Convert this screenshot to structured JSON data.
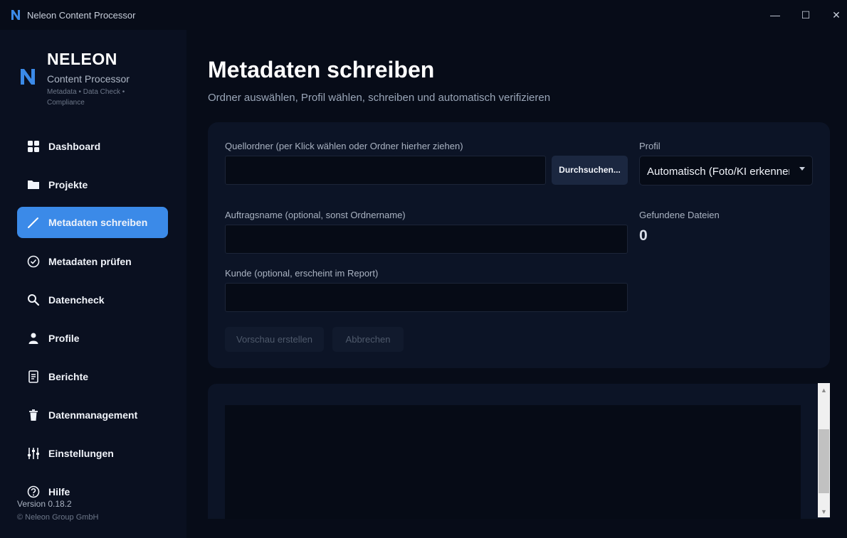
{
  "window": {
    "title": "Neleon Content Processor",
    "minimize_glyph": "—",
    "maximize_glyph": "☐",
    "close_glyph": "✕"
  },
  "brand": {
    "logo_letter": "N",
    "name": "NELEON",
    "subtitle": "Content Processor",
    "tagline": "Metadata • Data Check • Compliance",
    "accent_color": "#3b8ae8"
  },
  "sidebar": {
    "items": [
      {
        "label": "Dashboard",
        "icon": "grid-icon"
      },
      {
        "label": "Projekte",
        "icon": "folder-icon"
      },
      {
        "label": "Metadaten schreiben",
        "icon": "pencil-icon",
        "active": true
      },
      {
        "label": "Metadaten prüfen",
        "icon": "check-circle-icon"
      },
      {
        "label": "Datencheck",
        "icon": "search-icon"
      },
      {
        "label": "Profile",
        "icon": "person-icon"
      },
      {
        "label": "Berichte",
        "icon": "document-icon"
      },
      {
        "label": "Datenmanagement",
        "icon": "trash-icon"
      },
      {
        "label": "Einstellungen",
        "icon": "sliders-icon"
      },
      {
        "label": "Hilfe",
        "icon": "help-icon"
      }
    ],
    "version": "Version 0.18.2",
    "copyright": "© Neleon Group GmbH"
  },
  "main": {
    "title": "Metadaten schreiben",
    "subtitle": "Ordner auswählen, Profil wählen, schreiben und automatisch verifizieren",
    "form": {
      "source_label": "Quellordner (per Klick wählen oder Ordner hierher ziehen)",
      "source_value": "",
      "browse_label": "Durchsuchen...",
      "profile_label": "Profil",
      "profile_value": "Automatisch (Foto/KI erkennen)",
      "job_label": "Auftragsname (optional, sonst Ordnername)",
      "job_value": "",
      "found_label": "Gefundene Dateien",
      "found_count": "0",
      "customer_label": "Kunde (optional, erscheint im Report)",
      "customer_value": "",
      "preview_label": "Vorschau erstellen",
      "cancel_label": "Abbrechen"
    },
    "output": {
      "content": ""
    }
  }
}
